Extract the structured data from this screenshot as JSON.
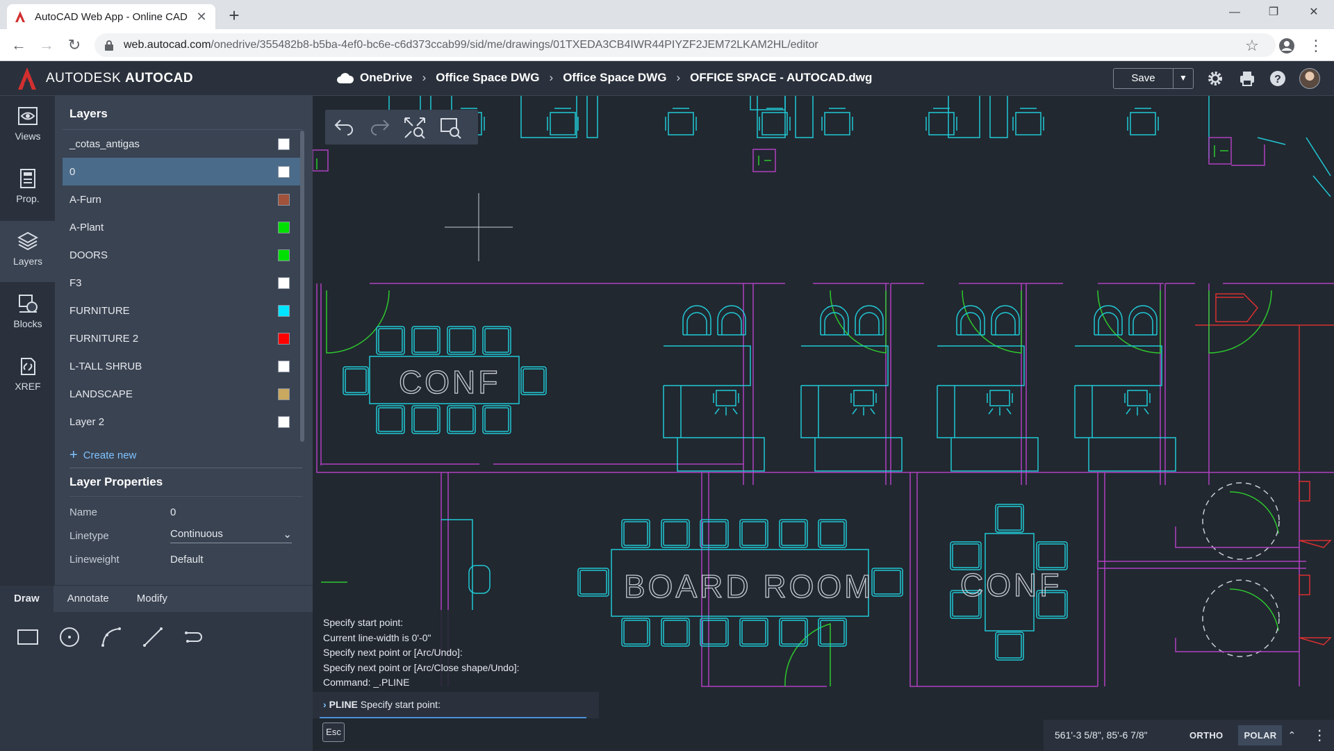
{
  "browser": {
    "tab_title": "AutoCAD Web App - Online CAD",
    "url_host": "web.autocad.com",
    "url_path": "/onedrive/355482b8-b5ba-4ef0-bc6e-c6d373ccab99/sid/me/drawings/01TXEDA3CB4IWR44PIYZF2JEM72LKAM2HL/editor"
  },
  "header": {
    "brand_autodesk": "AUTODESK",
    "brand_autocad": "AUTOCAD",
    "breadcrumb": [
      "OneDrive",
      "Office Space DWG",
      "Office Space DWG",
      "OFFICE SPACE - AUTOCAD.dwg"
    ],
    "save_label": "Save",
    "brand_color": "#d32f2f"
  },
  "rail": {
    "items": [
      {
        "label": "Views",
        "icon": "eye-icon"
      },
      {
        "label": "Prop.",
        "icon": "properties-icon"
      },
      {
        "label": "Layers",
        "icon": "layers-icon"
      },
      {
        "label": "Blocks",
        "icon": "blocks-icon"
      },
      {
        "label": "XREF",
        "icon": "xref-icon"
      }
    ],
    "active": "Layers"
  },
  "layers": {
    "title": "Layers",
    "items": [
      {
        "name": "_cotas_antigas",
        "color": "#ffffff"
      },
      {
        "name": "0",
        "color": "#ffffff",
        "selected": true
      },
      {
        "name": "A-Furn",
        "color": "#a0523a"
      },
      {
        "name": "A-Plant",
        "color": "#00e000"
      },
      {
        "name": "DOORS",
        "color": "#00e000"
      },
      {
        "name": "F3",
        "color": "#ffffff"
      },
      {
        "name": "FURNITURE",
        "color": "#00e5ff"
      },
      {
        "name": "FURNITURE 2",
        "color": "#ff0000"
      },
      {
        "name": "L-TALL SHRUB",
        "color": "#ffffff"
      },
      {
        "name": "LANDSCAPE",
        "color": "#c9a860"
      },
      {
        "name": "Layer 2",
        "color": "#ffffff"
      }
    ],
    "create_new": "Create new"
  },
  "layer_properties": {
    "title": "Layer Properties",
    "name_label": "Name",
    "name_value": "0",
    "linetype_label": "Linetype",
    "linetype_value": "Continuous",
    "lineweight_label": "Lineweight",
    "lineweight_value": "Default"
  },
  "draw_panel": {
    "tabs": [
      "Draw",
      "Annotate",
      "Modify"
    ],
    "active_tab": "Draw",
    "tools": [
      "rectangle-icon",
      "circle-icon",
      "arc-icon",
      "line-icon",
      "polyline-icon"
    ]
  },
  "canvas": {
    "room_labels": [
      "CONF",
      "BOARD ROOM",
      "CONF"
    ],
    "colors": {
      "walls": "#b040c0",
      "furniture": "#21c9d6",
      "doors": "#2ec82e",
      "fixtures": "#d93030"
    }
  },
  "command": {
    "history": [
      "Specify start point:",
      "Current line-width is 0'-0\"",
      "Specify next point or [Arc/Undo]:",
      "Specify next point or [Arc/Close shape/Undo]:",
      "Command: _.PLINE"
    ],
    "prompt_command": "PLINE",
    "prompt_text": "Specify start point:",
    "esc_label": "Esc"
  },
  "status": {
    "coords": "561'-3 5/8\", 85'-6 7/8\"",
    "ortho": "ORTHO",
    "polar": "POLAR"
  }
}
